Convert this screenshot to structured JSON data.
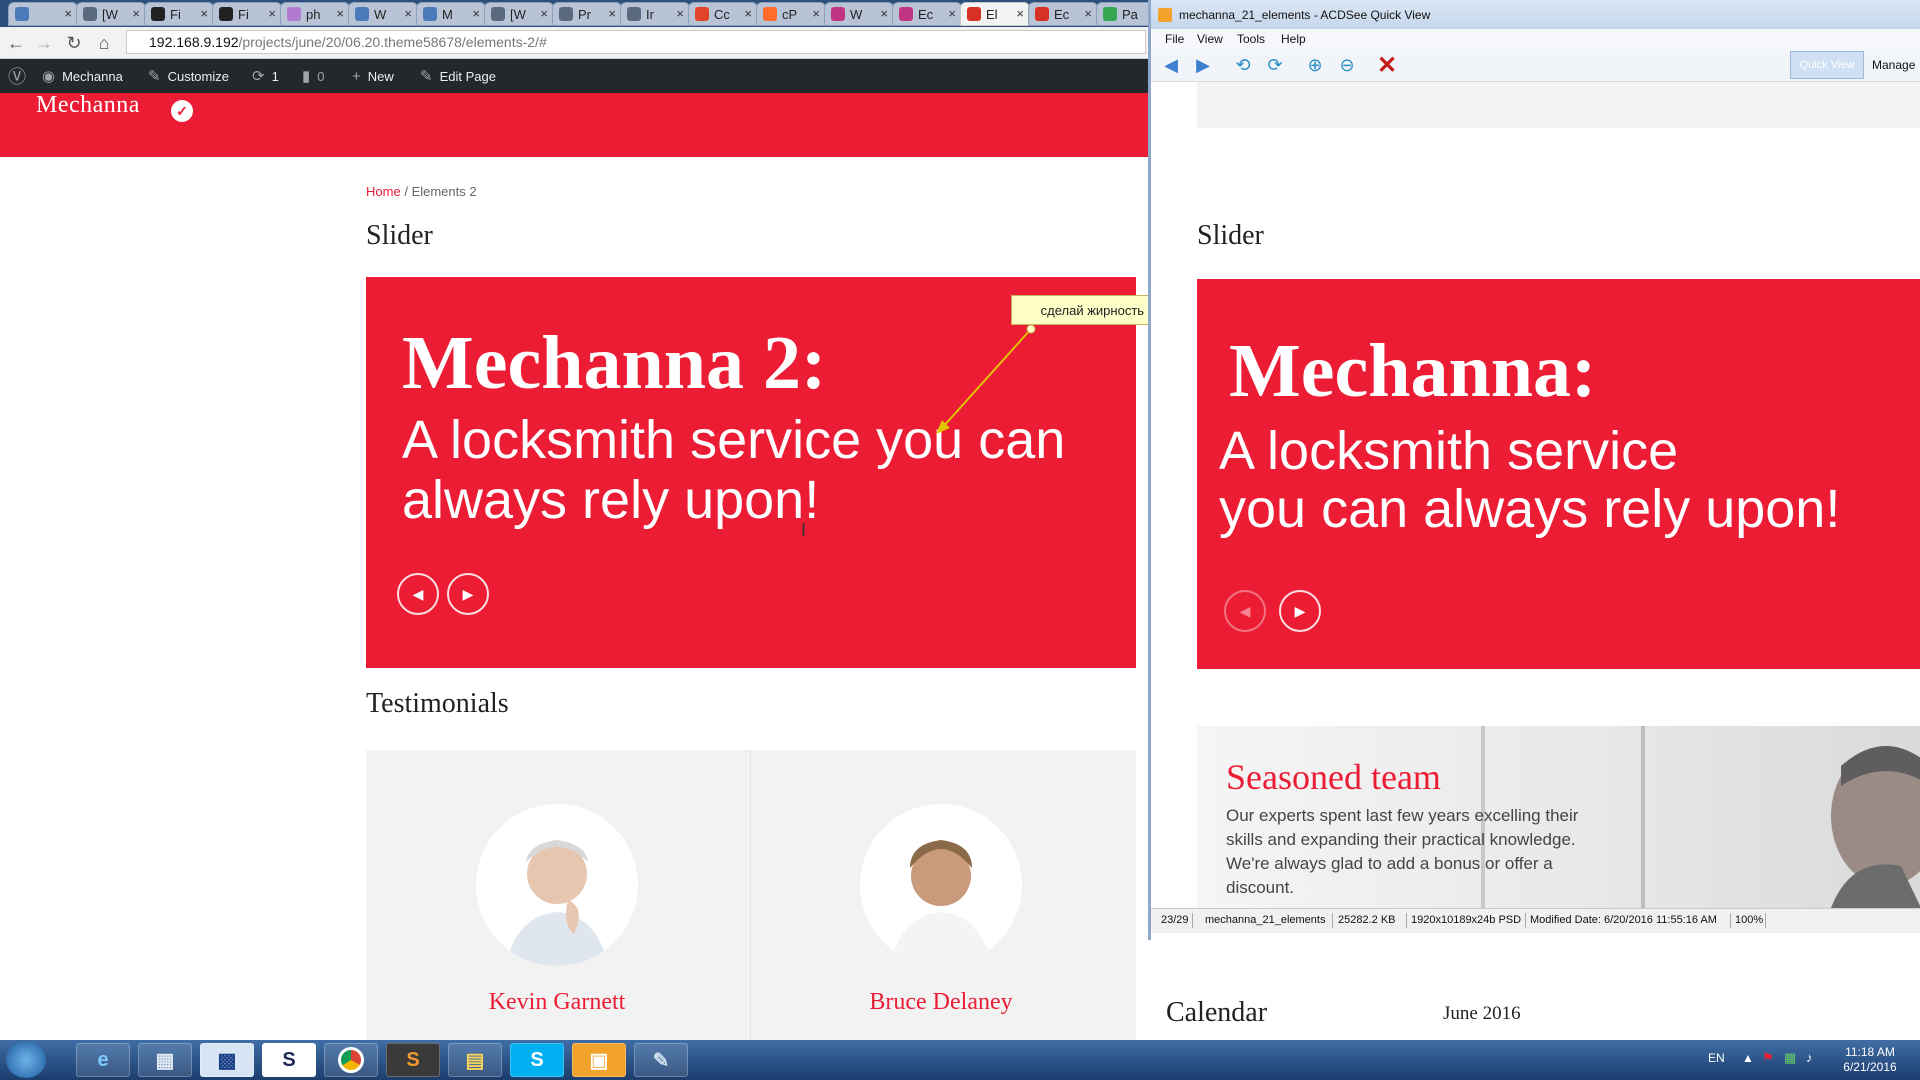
{
  "browser": {
    "tabs": [
      {
        "label": "",
        "icon": "mail-icon",
        "color": "#4d7bb9"
      },
      {
        "label": "[W",
        "icon": "wp-icon",
        "color": "#5a6b80"
      },
      {
        "label": "Fi",
        "icon": "github-icon",
        "color": "#222222"
      },
      {
        "label": "Fi",
        "icon": "github-icon",
        "color": "#222222"
      },
      {
        "label": "ph",
        "icon": "php-icon",
        "color": "#b07bd0"
      },
      {
        "label": "W",
        "icon": "mail-icon",
        "color": "#4d7bb9"
      },
      {
        "label": "M",
        "icon": "mail-icon",
        "color": "#4d7bb9"
      },
      {
        "label": "[W",
        "icon": "wp-icon",
        "color": "#5a6b80"
      },
      {
        "label": "Pr",
        "icon": "wp-icon",
        "color": "#5a6b80"
      },
      {
        "label": "Ir",
        "icon": "doc-icon",
        "color": "#5a6b80"
      },
      {
        "label": "Cc",
        "icon": "gitlab-icon",
        "color": "#e24329"
      },
      {
        "label": "cP",
        "icon": "cpanel-icon",
        "color": "#ff6c2c"
      },
      {
        "label": "W",
        "icon": "instagram-icon",
        "color": "#c13584"
      },
      {
        "label": "Ec",
        "icon": "instagram-icon",
        "color": "#c13584"
      },
      {
        "label": "El",
        "icon": "gmail-icon",
        "color": "#d93025",
        "active": true
      },
      {
        "label": "Ec",
        "icon": "gmail-icon",
        "color": "#d93025"
      },
      {
        "label": "Pa",
        "icon": "map-icon",
        "color": "#34a853"
      }
    ],
    "url_host": "192.168.9.192",
    "url_path": "/projects/june/20/06.20.theme58678/elements-2/#"
  },
  "wp_admin_bar": {
    "site_name": "Mechanna",
    "customize": "Customize",
    "updates_count": "1",
    "comments_count": "0",
    "new": "New",
    "edit_page": "Edit Page"
  },
  "site": {
    "title": "Mechanna",
    "breadcrumb_home": "Home",
    "breadcrumb_sep": "/",
    "breadcrumb_current": "Elements 2",
    "slider_heading": "Slider",
    "slider_title": "Mechanna 2:",
    "slider_subtitle": "A locksmith service you can always rely upon!",
    "testimonials_heading": "Testimonials",
    "testimonials": [
      {
        "name": "Kevin Garnett"
      },
      {
        "name": "Bruce Delaney"
      }
    ],
    "calendar_heading": "Calendar",
    "calendar_month": "June 2016",
    "accent_color": "#ec1c35"
  },
  "annotation_note": "сделай жирность как на псд",
  "acdsee": {
    "window_title": "mechanna_21_elements - ACDSee Quick View",
    "menu": [
      "File",
      "View",
      "Tools",
      "Help"
    ],
    "quick_view": "Quick View",
    "manage": "Manage",
    "preview": {
      "slider_heading": "Slider",
      "slider_title": "Mechanna:",
      "slider_subtitle_line1": "A locksmith service",
      "slider_subtitle_line2": "you can always rely upon!",
      "team_title": "Seasoned team",
      "team_text": "Our experts spent last few years excelling their skills and expanding their practical knowledge. We're always glad to add a bonus or offer a discount."
    },
    "status": {
      "position": "23/29",
      "filename": "mechanna_21_elements",
      "size": "25282.2 KB",
      "dimensions": "1920x10189x24b PSD",
      "modified": "Modified Date: 6/20/2016 11:55:16 AM",
      "zoom": "100%"
    }
  },
  "taskbar": {
    "language": "EN",
    "time": "11:18 AM",
    "date": "6/21/2016"
  }
}
